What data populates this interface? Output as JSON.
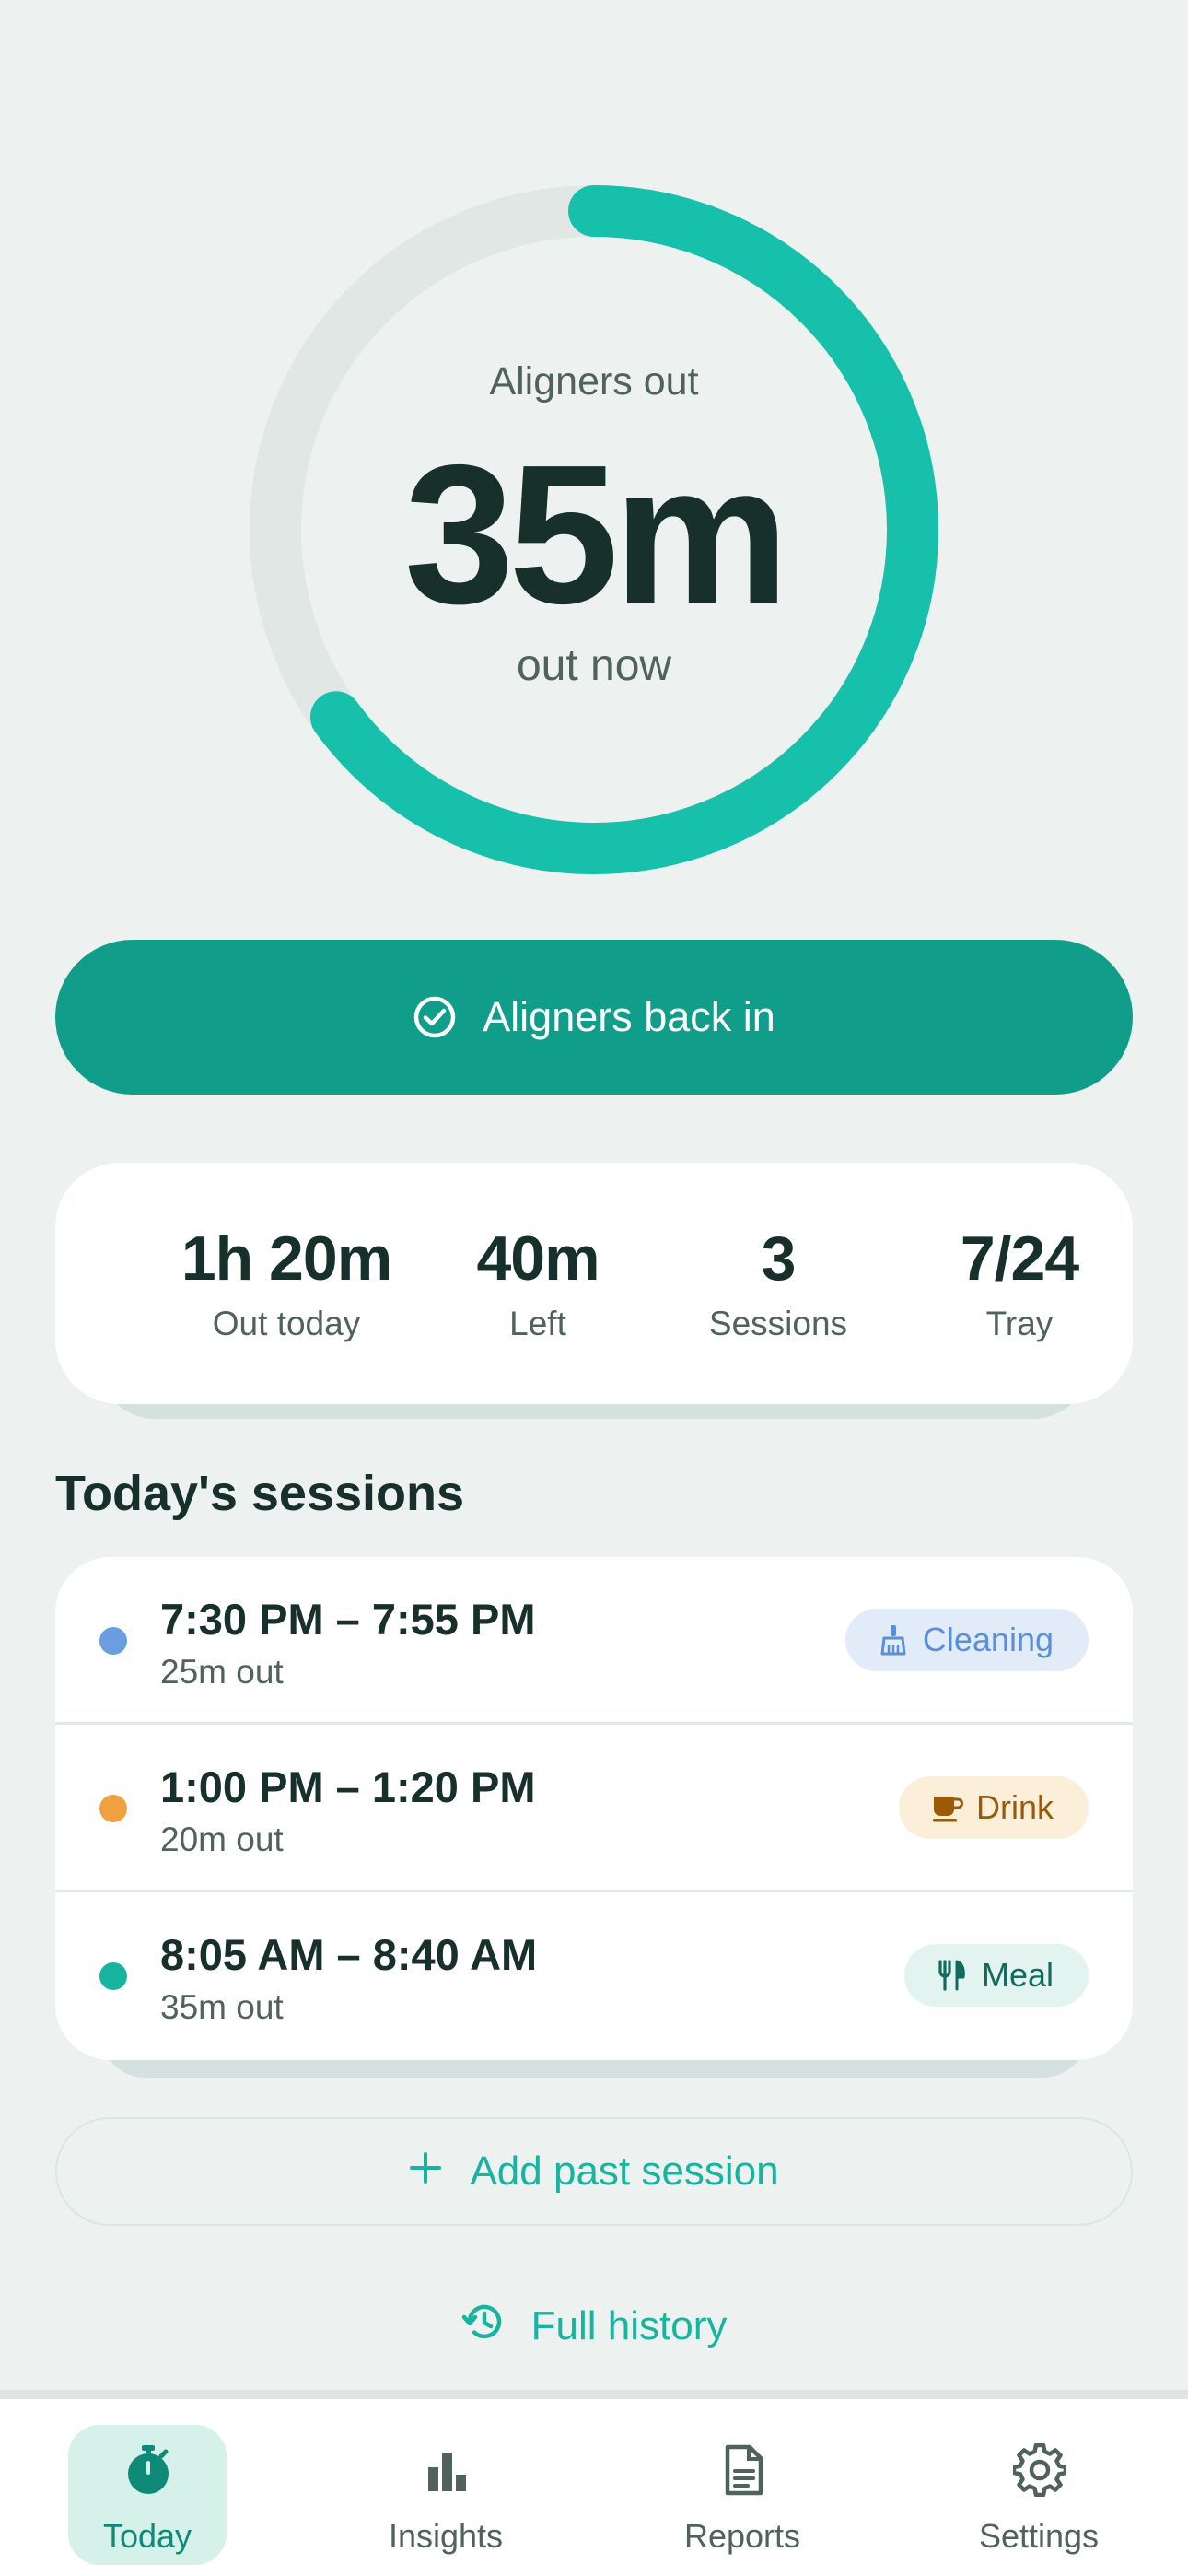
{
  "colors": {
    "accent": "#17b5a0",
    "primary": "#109d8a",
    "ring_track": "#e0e7e5",
    "text_dark": "#17302b",
    "text_muted": "#4f625e"
  },
  "timer": {
    "caption": "Aligners out",
    "value": "35m",
    "subtext": "out now",
    "ring_progress": 0.65
  },
  "primary_action": {
    "label": "Aligners back in",
    "icon": "check-circle-icon"
  },
  "stats": [
    {
      "value": "1h 20m",
      "label": "Out today"
    },
    {
      "value": "40m",
      "label": "Left"
    },
    {
      "value": "3",
      "label": "Sessions"
    },
    {
      "value": "7/24",
      "label": "Tray"
    }
  ],
  "sessions": {
    "title": "Today's sessions",
    "items": [
      {
        "time": "7:30 PM – 7:55 PM",
        "duration": "25m out",
        "dot_color": "#6a9ee0",
        "tag": "Cleaning",
        "tag_icon": "brush-icon"
      },
      {
        "time": "1:00 PM – 1:20 PM",
        "duration": "20m out",
        "dot_color": "#f0a040",
        "tag": "Drink",
        "tag_icon": "cup-icon"
      },
      {
        "time": "8:05 AM – 8:40 AM",
        "duration": "35m out",
        "dot_color": "#17b5a0",
        "tag": "Meal",
        "tag_icon": "utensils-icon"
      }
    ]
  },
  "add_past": {
    "label": "Add past session",
    "icon": "plus-icon"
  },
  "history": {
    "label": "Full history",
    "icon": "history-icon"
  },
  "nav": {
    "items": [
      {
        "label": "Today",
        "icon": "stopwatch-icon",
        "active": true
      },
      {
        "label": "Insights",
        "icon": "bar-chart-icon",
        "active": false
      },
      {
        "label": "Reports",
        "icon": "document-icon",
        "active": false
      },
      {
        "label": "Settings",
        "icon": "gear-icon",
        "active": false
      }
    ]
  }
}
